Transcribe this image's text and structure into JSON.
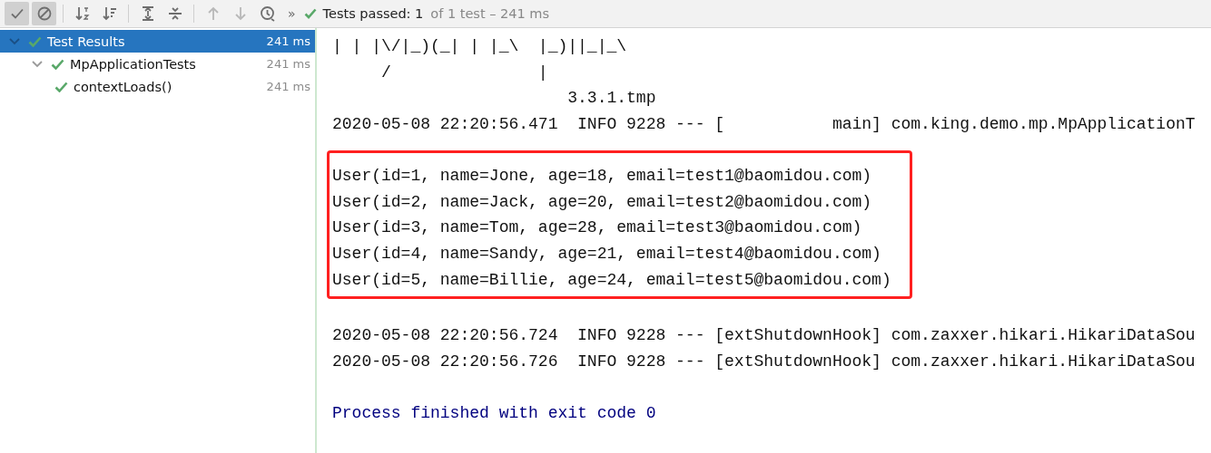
{
  "toolbar": {
    "buttons": [
      {
        "kind": "check",
        "selected": true,
        "disabled": false
      },
      {
        "kind": "ignored",
        "selected": true,
        "disabled": false
      },
      {
        "kind": "sort-alpha",
        "selected": false,
        "disabled": false
      },
      {
        "kind": "sort-duration",
        "selected": false,
        "disabled": false
      },
      {
        "kind": "expand",
        "selected": false,
        "disabled": false
      },
      {
        "kind": "collapse",
        "selected": false,
        "disabled": false
      },
      {
        "kind": "up",
        "selected": false,
        "disabled": true
      },
      {
        "kind": "down",
        "selected": false,
        "disabled": true
      },
      {
        "kind": "history",
        "selected": false,
        "disabled": false
      }
    ],
    "more": "»",
    "status_label": "Tests passed: 1",
    "status_detail": "of 1 test – 241 ms"
  },
  "tree": [
    {
      "label": "Test Results",
      "time": "241 ms",
      "selected": true,
      "expanded": true,
      "children": [
        {
          "label": "MpApplicationTests",
          "time": "241 ms",
          "selected": false,
          "expanded": true,
          "children": [
            {
              "label": "contextLoads()",
              "time": "241 ms",
              "selected": false
            }
          ]
        }
      ]
    }
  ],
  "console": {
    "blocks": [
      {
        "kind": "plain",
        "lines": [
          "| | |\\/|_)(_| | |_\\  |_)||_|_\\",
          "     /               |",
          "                        3.3.1.tmp",
          "2020-05-08 22:20:56.471  INFO 9228 --- [           main] com.king.demo.mp.MpApplicationT"
        ]
      },
      {
        "kind": "highlight",
        "lines": [
          "User(id=1, name=Jone, age=18, email=test1@baomidou.com)",
          "User(id=2, name=Jack, age=20, email=test2@baomidou.com)",
          "User(id=3, name=Tom, age=28, email=test3@baomidou.com)",
          "User(id=4, name=Sandy, age=21, email=test4@baomidou.com)",
          "User(id=5, name=Billie, age=24, email=test5@baomidou.com)"
        ]
      },
      {
        "kind": "plain",
        "lines": [
          "2020-05-08 22:20:56.724  INFO 9228 --- [extShutdownHook] com.zaxxer.hikari.HikariDataSou",
          "2020-05-08 22:20:56.726  INFO 9228 --- [extShutdownHook] com.zaxxer.hikari.HikariDataSou"
        ]
      },
      {
        "kind": "system",
        "lines": [
          "Process finished with exit code 0"
        ]
      }
    ]
  }
}
